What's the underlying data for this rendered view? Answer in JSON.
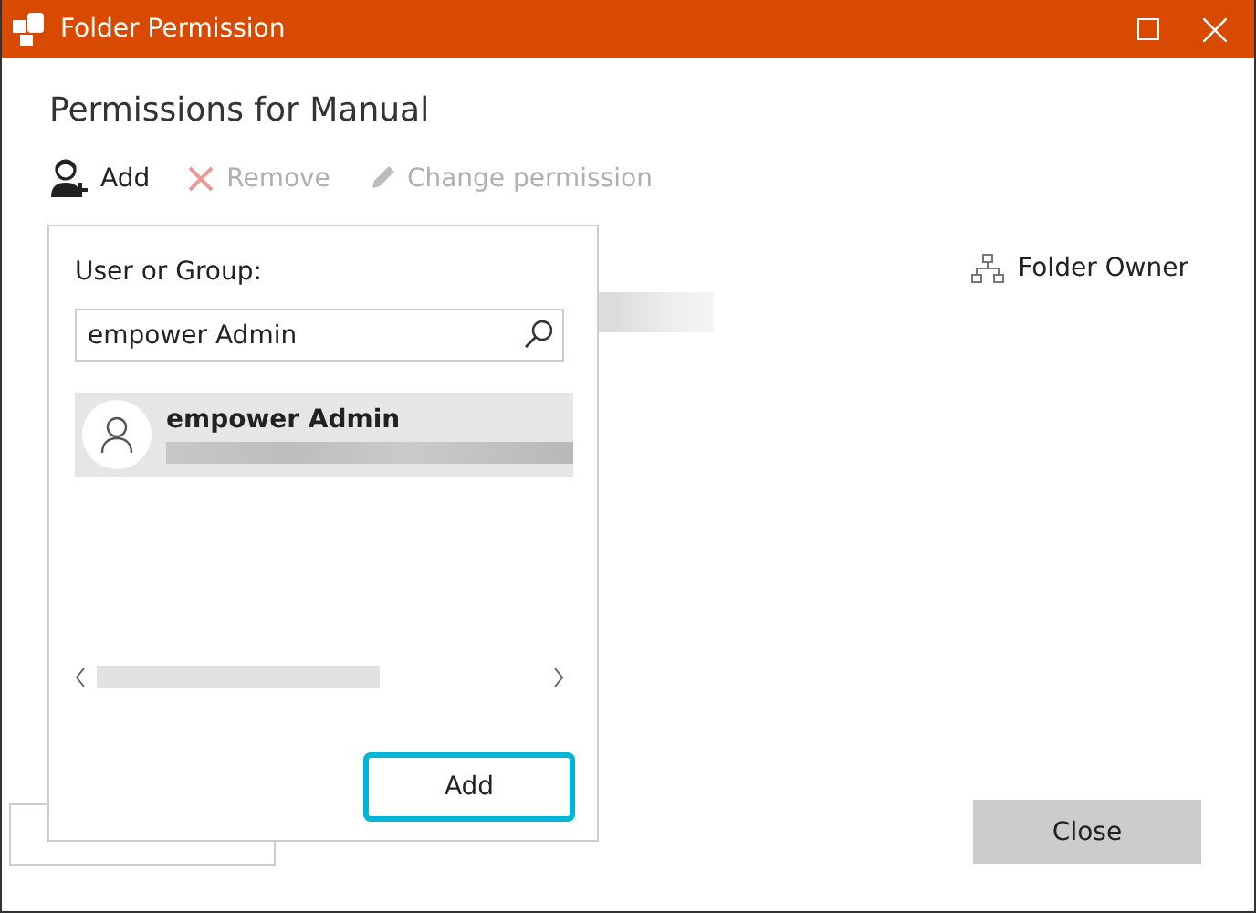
{
  "window": {
    "title": "Folder Permission"
  },
  "heading": "Permissions for Manual",
  "toolbar": [
    {
      "kind": "add",
      "label": "Add",
      "disabled": false
    },
    {
      "kind": "remove",
      "label": "Remove",
      "disabled": true
    },
    {
      "kind": "edit",
      "label": "Change permission",
      "disabled": true
    }
  ],
  "owner_label": "Folder Owner",
  "popup": {
    "label": "User or Group:",
    "search": {
      "value": "empower Admin"
    },
    "results": [
      {
        "name": "empower Admin",
        "selected": true
      }
    ],
    "add_button": "Add"
  },
  "close_button": "Close"
}
